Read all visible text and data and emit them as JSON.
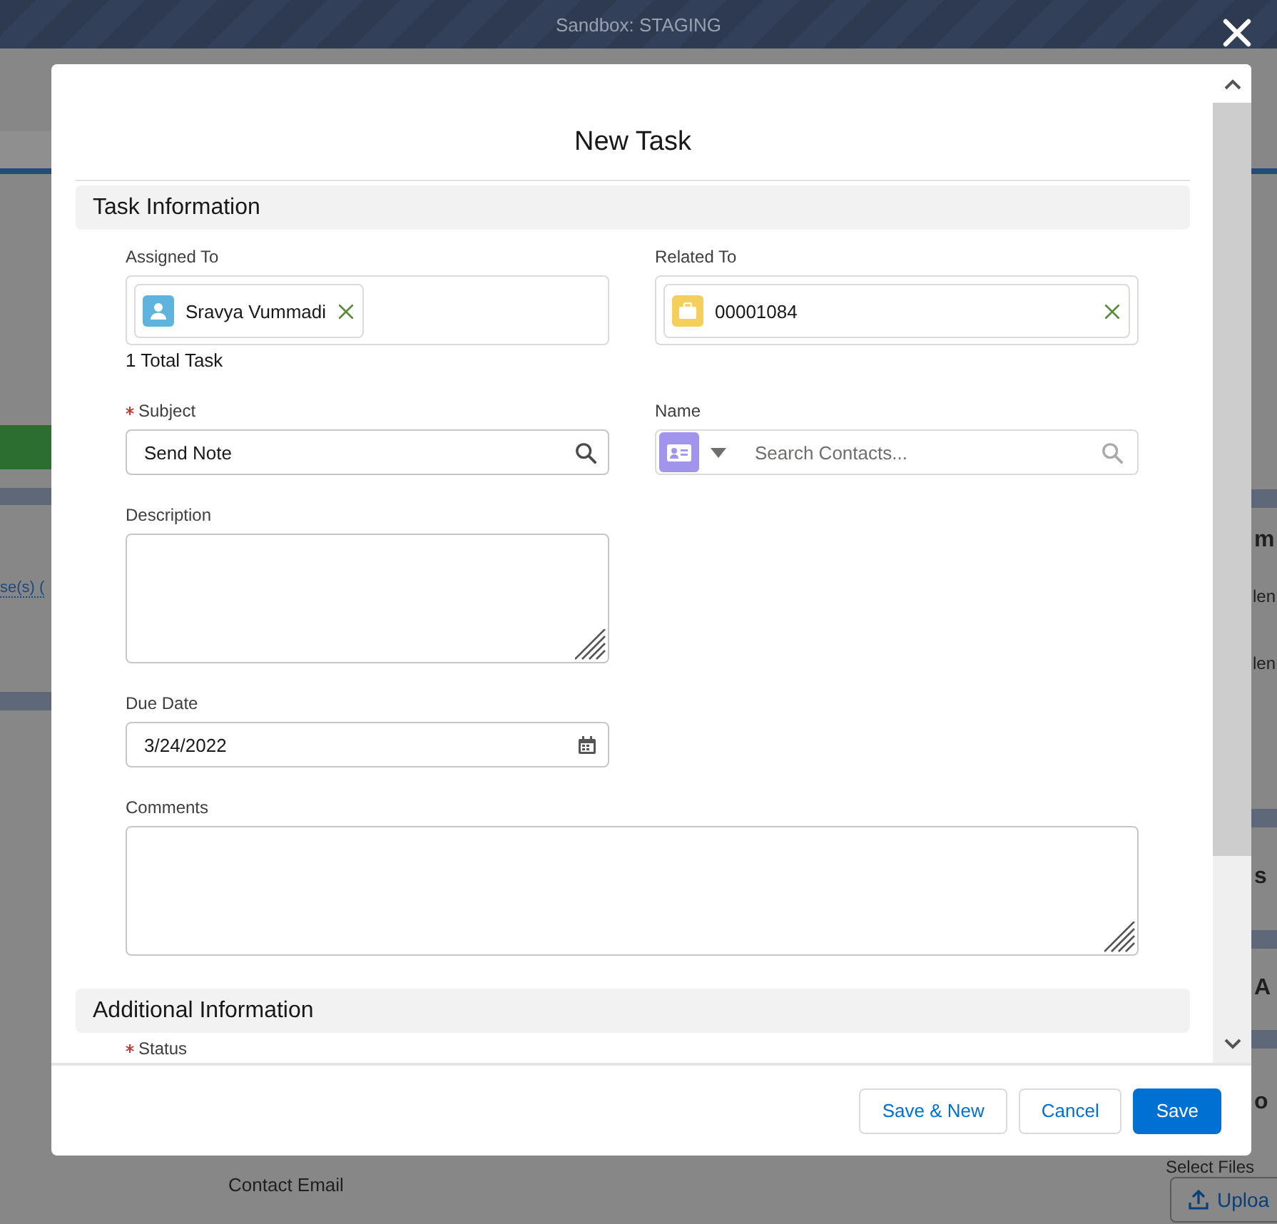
{
  "environment_bar": {
    "title": "Sandbox: STAGING"
  },
  "background_page": {
    "left_link": "se(s) (",
    "right_headings": [
      "m",
      "s",
      "A",
      "o"
    ],
    "right_rows": [
      "len",
      "len"
    ],
    "field_label": "Contact Email",
    "upload_hint": "Select Files",
    "upload_button": "Uploa"
  },
  "modal": {
    "title": "New Task",
    "sections": [
      {
        "title": "Task Information",
        "rows": [
          [
            {
              "kind": "user_pill",
              "label": "Assigned To",
              "value": "Sravya Vummadi",
              "note": "1 Total Task"
            },
            {
              "kind": "record_pill",
              "label": "Related To",
              "value": "00001084"
            }
          ],
          [
            {
              "kind": "search_input",
              "label": "Subject",
              "required": true,
              "value": "Send Note"
            },
            {
              "kind": "contact_lookup",
              "label": "Name",
              "placeholder": "Search Contacts..."
            }
          ],
          [
            {
              "kind": "textarea",
              "label": "Description"
            }
          ],
          [
            {
              "kind": "date",
              "label": "Due Date",
              "value": "3/24/2022"
            }
          ],
          [
            {
              "kind": "wide_textarea",
              "label": "Comments"
            }
          ]
        ]
      },
      {
        "title": "Additional Information",
        "rows": [
          [
            {
              "kind": "label",
              "label": "Status",
              "required": true
            }
          ]
        ]
      }
    ],
    "buttons": [
      {
        "label": "Save & New",
        "kind": "neutral"
      },
      {
        "label": "Cancel",
        "kind": "neutral"
      },
      {
        "label": "Save",
        "kind": "brand"
      }
    ]
  }
}
